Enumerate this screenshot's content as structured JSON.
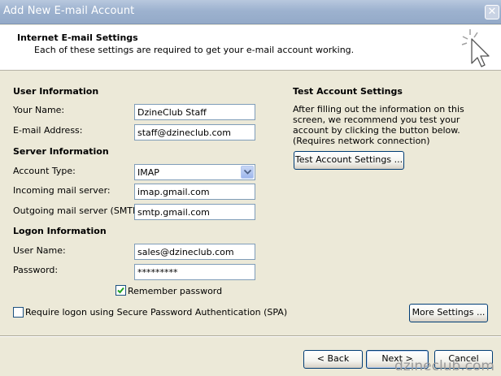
{
  "window": {
    "title": "Add New E-mail Account",
    "close_glyph": "✕"
  },
  "header": {
    "title": "Internet E-mail Settings",
    "subtitle": "Each of these settings are required to get your e-mail account working.",
    "icon": "wand-cursor-icon"
  },
  "user_info": {
    "section": "User Information",
    "name_label": "Your Name:",
    "name_value": "DzineClub Staff",
    "email_label": "E-mail Address:",
    "email_value": "staff@dzineclub.com"
  },
  "server_info": {
    "section": "Server Information",
    "account_type_label": "Account Type:",
    "account_type_value": "IMAP",
    "incoming_label": "Incoming mail server:",
    "incoming_value": "imap.gmail.com",
    "outgoing_label": "Outgoing mail server (SMTP):",
    "outgoing_value": "smtp.gmail.com"
  },
  "logon_info": {
    "section": "Logon Information",
    "username_label": "User Name:",
    "username_value": "sales@dzineclub.com",
    "password_label": "Password:",
    "password_value": "*********",
    "remember_label": "Remember password",
    "remember_checked": true,
    "spa_label": "Require logon using Secure Password Authentication (SPA)",
    "spa_checked": false
  },
  "test_settings": {
    "section": "Test Account Settings",
    "description": "After filling out the information on this screen, we recommend you test your account by clicking the button below. (Requires network connection)",
    "button": "Test Account Settings ..."
  },
  "buttons": {
    "more": "More Settings ...",
    "back": "< Back",
    "next": "Next >",
    "cancel": "Cancel"
  },
  "watermark": "dzineclub.com"
}
